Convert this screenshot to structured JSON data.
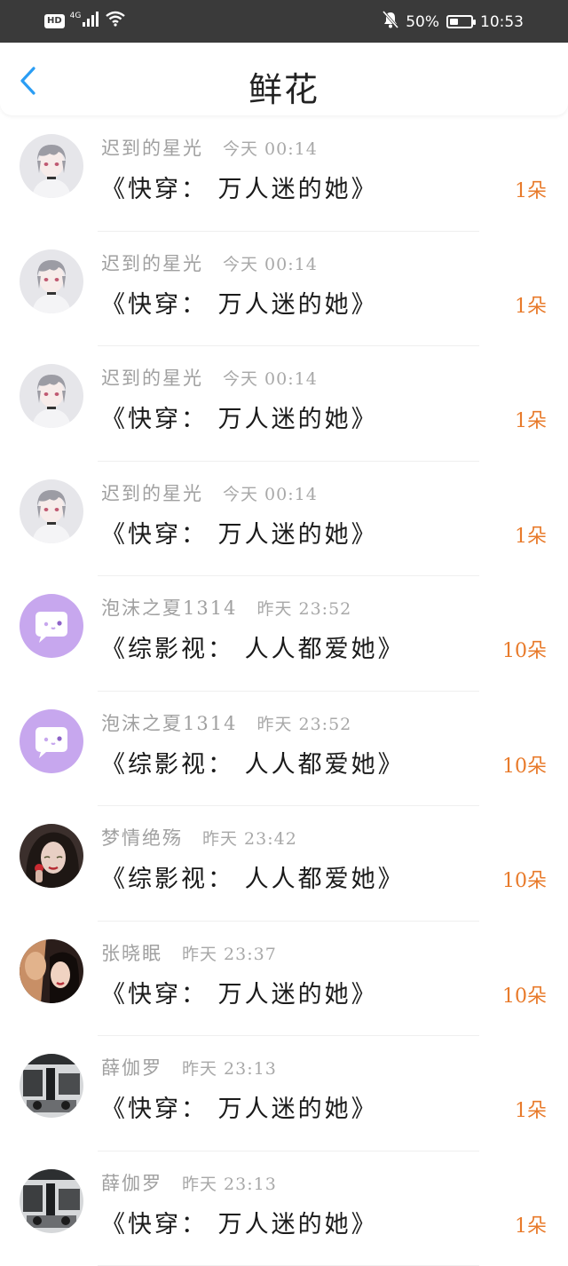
{
  "status_bar": {
    "hd": "HD",
    "network": "4G",
    "battery_percent": "50%",
    "battery_level": 0.5,
    "time": "10:53",
    "icons": [
      "signal-icon",
      "wifi-icon",
      "mute-bell-icon",
      "battery-icon"
    ]
  },
  "header": {
    "title": "鲜花",
    "back_icon": "chevron-left-icon"
  },
  "colors": {
    "accent_blue": "#2a9df4",
    "flower_orange": "#e87a2a",
    "name_gray": "#a0a0a0",
    "status_bar_bg": "#3a3a3a"
  },
  "rows": [
    {
      "name": "迟到的星光",
      "time": "今天 00:14",
      "book": "《快穿： 万人迷的她》",
      "count": "1朵",
      "avatar": "anime-boy-avatar"
    },
    {
      "name": "迟到的星光",
      "time": "今天 00:14",
      "book": "《快穿： 万人迷的她》",
      "count": "1朵",
      "avatar": "anime-boy-avatar"
    },
    {
      "name": "迟到的星光",
      "time": "今天 00:14",
      "book": "《快穿： 万人迷的她》",
      "count": "1朵",
      "avatar": "anime-boy-avatar"
    },
    {
      "name": "迟到的星光",
      "time": "今天 00:14",
      "book": "《快穿： 万人迷的她》",
      "count": "1朵",
      "avatar": "anime-boy-avatar"
    },
    {
      "name": "泡沫之夏1314",
      "time": "昨天 23:52",
      "book": "《综影视： 人人都爱她》",
      "count": "10朵",
      "avatar": "default-chat-avatar"
    },
    {
      "name": "泡沫之夏1314",
      "time": "昨天 23:52",
      "book": "《综影视： 人人都爱她》",
      "count": "10朵",
      "avatar": "default-chat-avatar"
    },
    {
      "name": "梦情绝殇",
      "time": "昨天 23:42",
      "book": "《综影视： 人人都爱她》",
      "count": "10朵",
      "avatar": "woman-photo-avatar"
    },
    {
      "name": "张晓眠",
      "time": "昨天 23:37",
      "book": "《快穿： 万人迷的她》",
      "count": "10朵",
      "avatar": "couple-photo-avatar"
    },
    {
      "name": "薛伽罗",
      "time": "昨天 23:13",
      "book": "《快穿： 万人迷的她》",
      "count": "1朵",
      "avatar": "monochrome-photo-avatar"
    },
    {
      "name": "薛伽罗",
      "time": "昨天 23:13",
      "book": "《快穿： 万人迷的她》",
      "count": "1朵",
      "avatar": "monochrome-photo-avatar"
    }
  ]
}
